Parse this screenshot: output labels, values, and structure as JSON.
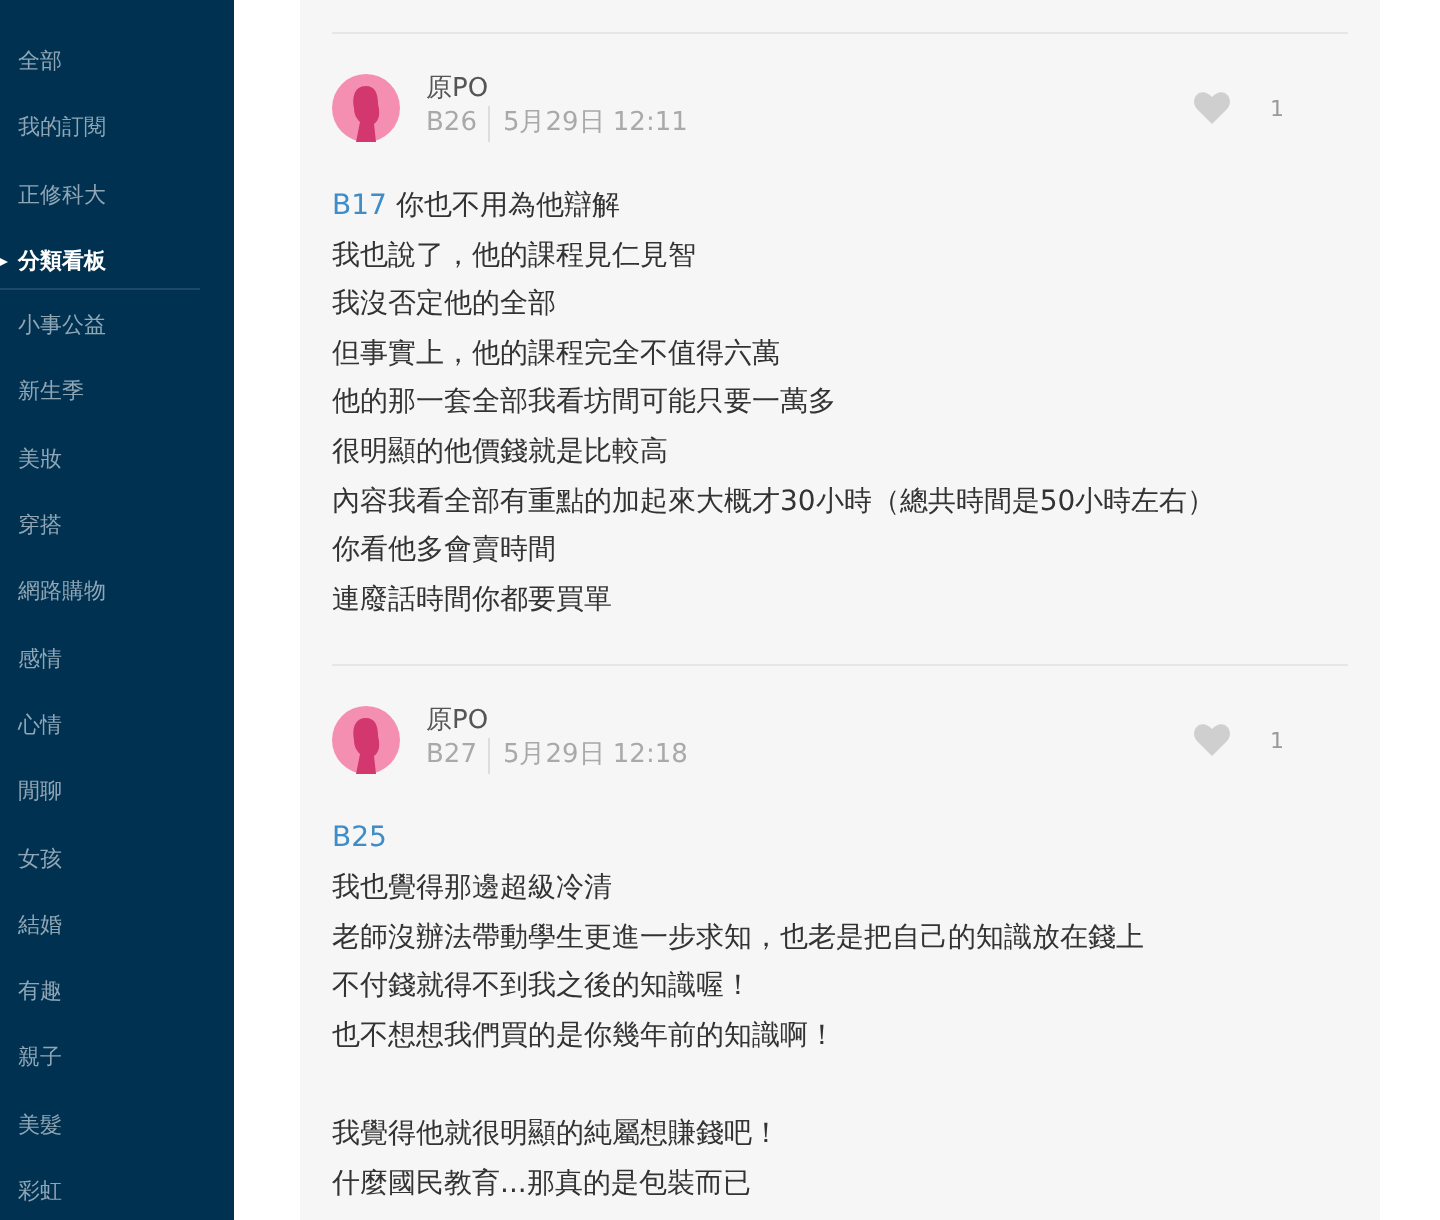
{
  "sidebar": {
    "items": [
      {
        "label": "全部",
        "selected": false
      },
      {
        "label": "我的訂閱",
        "selected": false
      },
      {
        "label": "正修科大",
        "selected": false
      },
      {
        "label": "分類看板",
        "selected": true
      },
      {
        "label": "小事公益",
        "selected": false
      },
      {
        "label": "新生季",
        "selected": false
      },
      {
        "label": "美妝",
        "selected": false
      },
      {
        "label": "穿搭",
        "selected": false
      },
      {
        "label": "網路購物",
        "selected": false
      },
      {
        "label": "感情",
        "selected": false
      },
      {
        "label": "心情",
        "selected": false
      },
      {
        "label": "閒聊",
        "selected": false
      },
      {
        "label": "女孩",
        "selected": false
      },
      {
        "label": "結婚",
        "selected": false
      },
      {
        "label": "有趣",
        "selected": false
      },
      {
        "label": "親子",
        "selected": false
      },
      {
        "label": "美髮",
        "selected": false
      },
      {
        "label": "彩虹",
        "selected": false
      }
    ]
  },
  "comments": [
    {
      "author": "原PO",
      "floor": "B26",
      "time": "5月29日 12:11",
      "likes": "1",
      "paragraphs": [
        [
          {
            "reply_to": "B17",
            "text": "你也不用為他辯解"
          },
          {
            "text": "我也說了，他的課程見仁見智"
          },
          {
            "text": "我沒否定他的全部"
          },
          {
            "text": "但事實上，他的課程完全不值得六萬"
          },
          {
            "text": "他的那一套全部我看坊間可能只要一萬多"
          },
          {
            "text": "很明顯的他價錢就是比較高"
          },
          {
            "text": "內容我看全部有重點的加起來大概才30小時（總共時間是50小時左右）"
          },
          {
            "text": "你看他多會賣時間"
          },
          {
            "text": "連廢話時間你都要買單"
          }
        ]
      ]
    },
    {
      "author": "原PO",
      "floor": "B27",
      "time": "5月29日 12:18",
      "likes": "1",
      "paragraphs": [
        [
          {
            "reply_to": "B25"
          },
          {
            "text": "我也覺得那邊超級冷清"
          },
          {
            "text": "老師沒辦法帶動學生更進一步求知，也老是把自己的知識放在錢上"
          },
          {
            "text": "不付錢就得不到我之後的知識喔！"
          },
          {
            "text": "也不想想我們買的是你幾年前的知識啊！"
          }
        ],
        [
          {
            "text": "我覺得他就很明顯的純屬想賺錢吧！"
          },
          {
            "text": "什麼國民教育...那真的是包裝而已"
          }
        ]
      ]
    }
  ]
}
